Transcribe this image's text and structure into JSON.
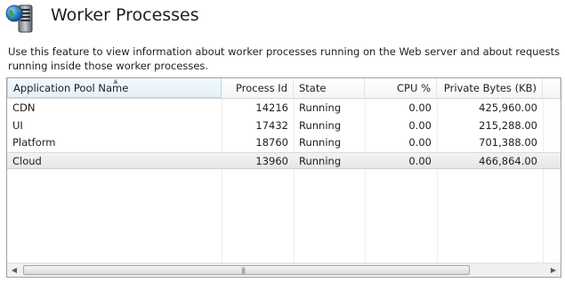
{
  "header": {
    "title": "Worker Processes",
    "icon": "worker-processes-icon"
  },
  "description": "Use this feature to view information about worker processes running on the Web server and about requests running inside those worker processes.",
  "grid": {
    "columns": [
      {
        "label": "Application Pool Name",
        "sorted": "ascending"
      },
      {
        "label": "Process Id"
      },
      {
        "label": "State"
      },
      {
        "label": "CPU %"
      },
      {
        "label": "Private Bytes (KB)"
      }
    ],
    "rows": [
      {
        "name": "CDN",
        "pid": "14216",
        "state": "Running",
        "cpu": "0.00",
        "bytes": "425,960.00"
      },
      {
        "name": "UI",
        "pid": "17432",
        "state": "Running",
        "cpu": "0.00",
        "bytes": "215,288.00"
      },
      {
        "name": "Platform",
        "pid": "18760",
        "state": "Running",
        "cpu": "0.00",
        "bytes": "701,388.00"
      },
      {
        "name": "Cloud",
        "pid": "13960",
        "state": "Running",
        "cpu": "0.00",
        "bytes": "466,864.00"
      }
    ],
    "selected_row": 3
  },
  "colors": {
    "sorted_header": "#e4f1fb",
    "selected_row": "#e8e8e8",
    "border": "#a0a0a0"
  }
}
